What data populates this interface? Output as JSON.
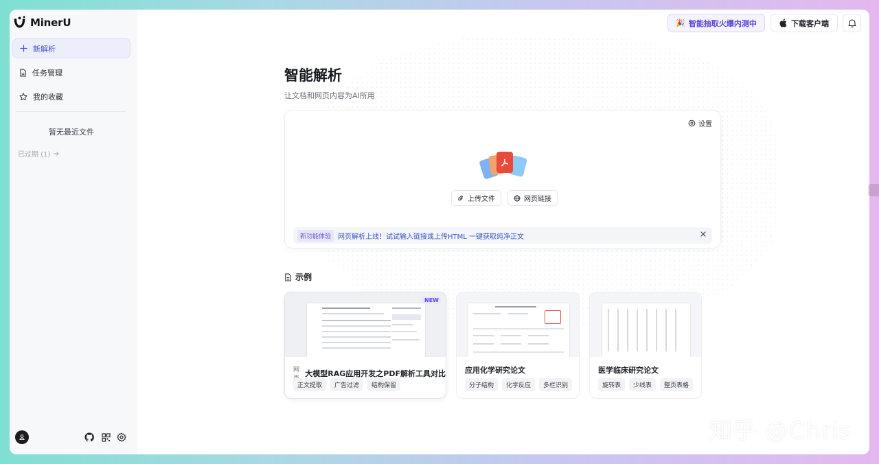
{
  "brand": {
    "name": "MinerU"
  },
  "sidebar": {
    "items": [
      {
        "label": "新解析",
        "icon": "plus-icon"
      },
      {
        "label": "任务管理",
        "icon": "document-icon"
      },
      {
        "label": "我的收藏",
        "icon": "star-icon"
      }
    ],
    "empty_recent": "暂无最近文件",
    "expired": "已过期 (1)"
  },
  "header": {
    "beta_label": "智能抽取火爆内测中",
    "download_label": "下载客户端"
  },
  "main": {
    "title": "智能解析",
    "subtitle": "让文档和网页内容为AI所用",
    "settings_label": "设置",
    "upload_file_label": "上传文件",
    "web_link_label": "网页链接",
    "notice_tag": "新功能体验",
    "notice_text": "网页解析上线！试试输入链接或上传HTML 一键获取纯净正文"
  },
  "examples": {
    "heading": "示例",
    "cards": [
      {
        "badge": "NEW",
        "type": "网页",
        "title": "大模型RAG应用开发之PDF解析工具对比",
        "tags": [
          "正文提取",
          "广告过滤",
          "结构保留"
        ]
      },
      {
        "title": "应用化学研究论文",
        "tags": [
          "分子结构",
          "化学反应",
          "多栏识别"
        ]
      },
      {
        "title": "医学临床研究论文",
        "tags": [
          "旋转表",
          "少线表",
          "整页表格"
        ]
      }
    ]
  },
  "watermark": "知乎 @Chris",
  "colors": {
    "accent": "#5a46d8",
    "link": "#3d56c9",
    "background_from": "#7ee0d2",
    "background_to": "#e4b8ee"
  }
}
